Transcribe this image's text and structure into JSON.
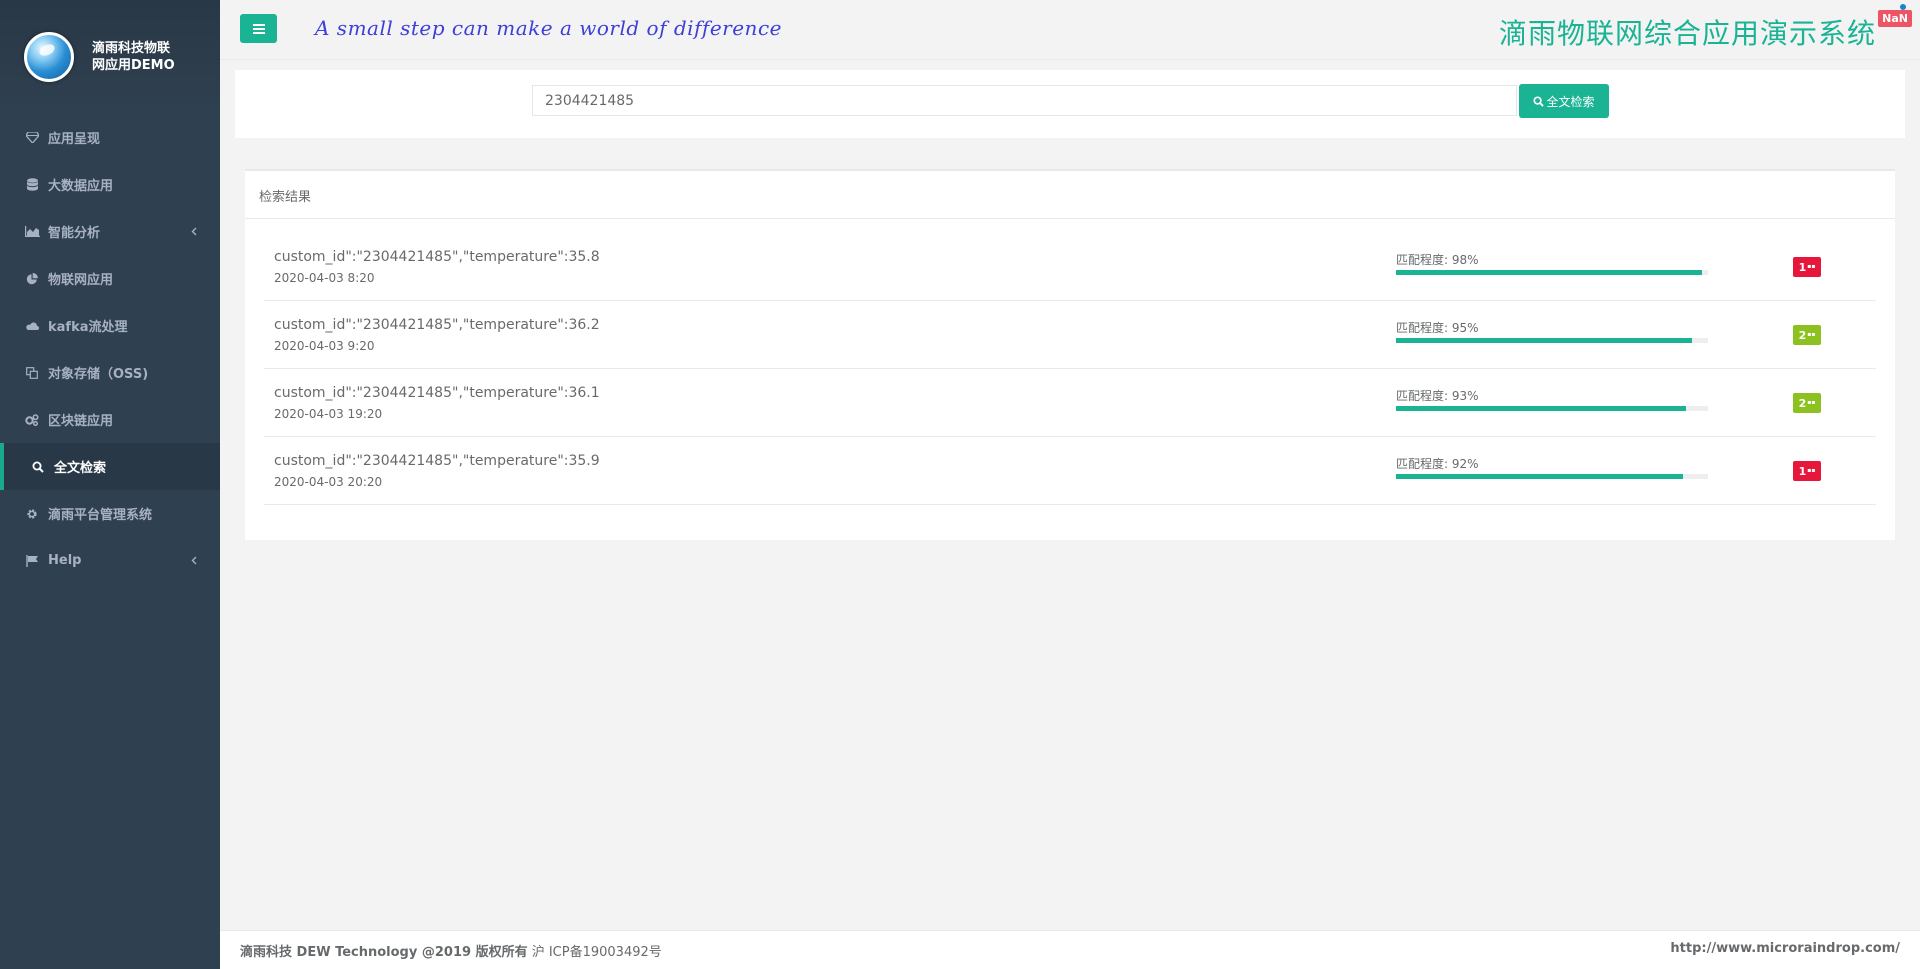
{
  "brand": {
    "name_line1": "滴雨科技物联",
    "name_line2": "网应用DEMO"
  },
  "sidebar": {
    "items": [
      {
        "label": "应用呈现",
        "icon": "diamond-icon"
      },
      {
        "label": "大数据应用",
        "icon": "database-icon"
      },
      {
        "label": "智能分析",
        "icon": "area-chart-icon",
        "has_submenu": true
      },
      {
        "label": "物联网应用",
        "icon": "pie-chart-icon"
      },
      {
        "label": "kafka流处理",
        "icon": "cloud-icon"
      },
      {
        "label": "对象存储（OSS)",
        "icon": "copy-icon"
      },
      {
        "label": "区块链应用",
        "icon": "cogs-icon"
      },
      {
        "label": "全文检索",
        "icon": "search-icon",
        "active": true
      },
      {
        "label": "滴雨平台管理系统",
        "icon": "gear-icon"
      },
      {
        "label": "Help",
        "icon": "flag-icon",
        "has_submenu": true
      }
    ]
  },
  "header": {
    "slogan": "A small step can make a world of difference",
    "title": "滴雨物联网综合应用演示系统",
    "badge": "NaN"
  },
  "search": {
    "value": "2304421485",
    "button_label": "全文检索"
  },
  "results": {
    "title": "检索结果",
    "items": [
      {
        "text": "custom_id\":\"2304421485\",\"temperature\":35.8",
        "date": "2020-04-03 8:20",
        "match_label": "匹配程度: 98%",
        "match": 98,
        "badge": "1",
        "badge_color": "#e6173a"
      },
      {
        "text": "custom_id\":\"2304421485\",\"temperature\":36.2",
        "date": "2020-04-03 9:20",
        "match_label": "匹配程度: 95%",
        "match": 95,
        "badge": "2",
        "badge_color": "#8cc11f"
      },
      {
        "text": "custom_id\":\"2304421485\",\"temperature\":36.1",
        "date": "2020-04-03 19:20",
        "match_label": "匹配程度: 93%",
        "match": 93,
        "badge": "2",
        "badge_color": "#8cc11f"
      },
      {
        "text": "custom_id\":\"2304421485\",\"temperature\":35.9",
        "date": "2020-04-03 20:20",
        "match_label": "匹配程度: 92%",
        "match": 92,
        "badge": "1",
        "badge_color": "#e6173a"
      }
    ]
  },
  "footer": {
    "left_bold": "滴雨科技 DEW Technology @2019 版权所有",
    "left_icp": " 沪 ICP备19003492号",
    "right": "http://www.microraindrop.com/"
  },
  "colors": {
    "accent": "#1ab394",
    "sidebar_bg": "#2f4050",
    "nav_text": "#a7b1c2",
    "badge_red": "#ed5565"
  }
}
